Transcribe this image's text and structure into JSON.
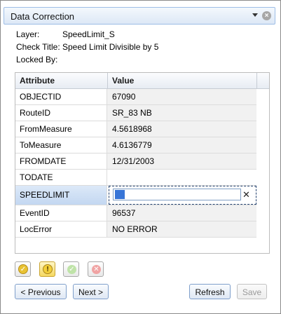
{
  "panel": {
    "title": "Data Correction"
  },
  "meta": {
    "layer_label": "Layer:",
    "layer_value": "SpeedLimit_S",
    "check_label": "Check Title:",
    "check_value": "Speed Limit Divisible by 5",
    "locked_label": "Locked By:",
    "locked_value": ""
  },
  "grid": {
    "headers": [
      "Attribute",
      "Value"
    ],
    "rows": [
      {
        "attr": "OBJECTID",
        "value": "67090"
      },
      {
        "attr": "RouteID",
        "value": "SR_83 NB"
      },
      {
        "attr": "FromMeasure",
        "value": "4.5618968"
      },
      {
        "attr": "ToMeasure",
        "value": "4.6136779"
      },
      {
        "attr": "FROMDATE",
        "value": "12/31/2003"
      },
      {
        "attr": "TODATE",
        "value": ""
      },
      {
        "attr": "SPEEDLIMIT",
        "value": "24"
      },
      {
        "attr": "EventID",
        "value": "96537"
      },
      {
        "attr": "LocError",
        "value": "NO ERROR"
      }
    ]
  },
  "buttons": {
    "previous": "< Previous",
    "next": "Next >",
    "refresh": "Refresh",
    "save": "Save"
  },
  "icons": {
    "approve_yellow": "check-yellow-icon",
    "warning_yellow": "exclamation-yellow-icon",
    "approve_green": "check-green-icon",
    "reject_red": "x-red-icon"
  }
}
